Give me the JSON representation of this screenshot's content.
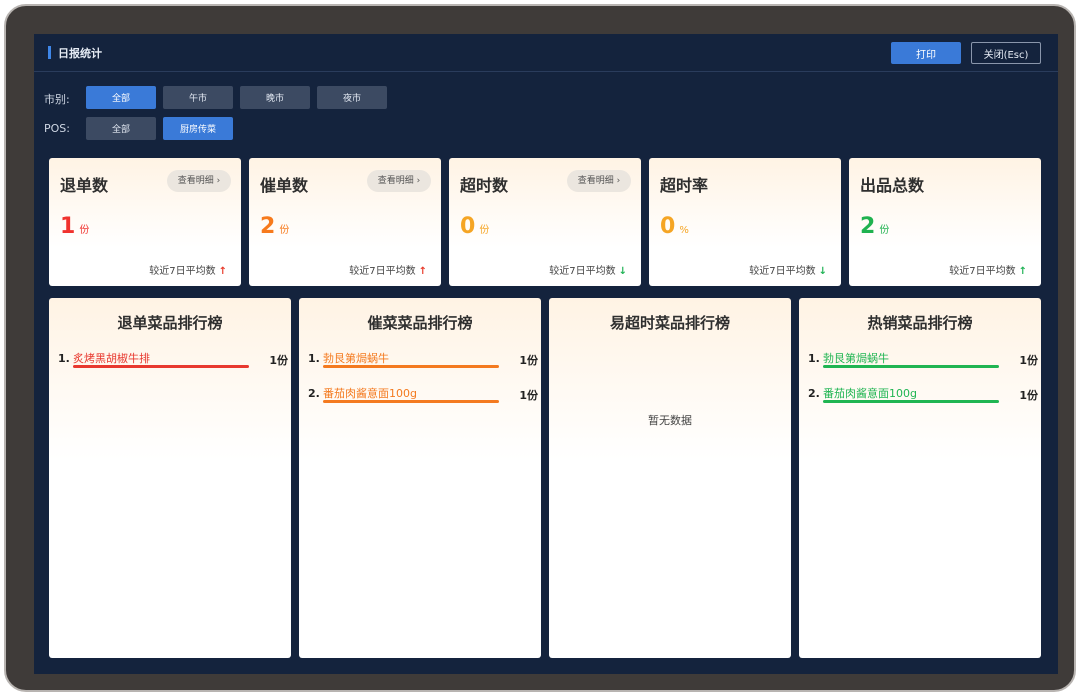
{
  "header": {
    "title": "日报统计",
    "print_label": "打印",
    "close_label": "关闭(Esc)"
  },
  "filters": {
    "market_label": "市别:",
    "market_options": [
      "全部",
      "午市",
      "晚市",
      "夜市"
    ],
    "market_selected": "全部",
    "pos_label": "POS:",
    "pos_options": [
      "全部",
      "厨房传菜"
    ],
    "pos_selected": "厨房传菜"
  },
  "stats": [
    {
      "title": "退单数",
      "detail": "查看明细",
      "value": "1",
      "unit": "份",
      "compare": "较近7日平均数",
      "trend": "up",
      "value_color": "#f0322d",
      "arrow_color": "#e83b2b"
    },
    {
      "title": "催单数",
      "detail": "查看明细",
      "value": "2",
      "unit": "份",
      "compare": "较近7日平均数",
      "trend": "up",
      "value_color": "#f77a1c",
      "arrow_color": "#e83b2b"
    },
    {
      "title": "超时数",
      "detail": "查看明细",
      "value": "0",
      "unit": "份",
      "compare": "较近7日平均数",
      "trend": "down",
      "value_color": "#f5a524",
      "arrow_color": "#22b357"
    },
    {
      "title": "超时率",
      "value": "0",
      "unit": "%",
      "compare": "较近7日平均数",
      "trend": "down",
      "value_color": "#f5a524",
      "arrow_color": "#22b357"
    },
    {
      "title": "出品总数",
      "value": "2",
      "unit": "份",
      "compare": "较近7日平均数",
      "trend": "up",
      "value_color": "#1fb24f",
      "arrow_color": "#22b357"
    }
  ],
  "rankings": [
    {
      "title": "退单菜品排行榜",
      "color": "#e8392f",
      "items": [
        {
          "no": "1.",
          "name": "炙烤黑胡椒牛排",
          "count": "1份",
          "ratio": 1.0
        }
      ]
    },
    {
      "title": "催菜菜品排行榜",
      "color": "#f47a1f",
      "items": [
        {
          "no": "1.",
          "name": "勃艮第焗蜗牛",
          "count": "1份",
          "ratio": 1.0
        },
        {
          "no": "2.",
          "name": "番茄肉酱意面100g",
          "count": "1份",
          "ratio": 1.0
        }
      ]
    },
    {
      "title": "易超时菜品排行榜",
      "color": "#f5a524",
      "items": [],
      "empty_text": "暂无数据"
    },
    {
      "title": "热销菜品排行榜",
      "color": "#20b552",
      "items": [
        {
          "no": "1.",
          "name": "勃艮第焗蜗牛",
          "count": "1份",
          "ratio": 1.0
        },
        {
          "no": "2.",
          "name": "番茄肉酱意面100g",
          "count": "1份",
          "ratio": 1.0
        }
      ]
    }
  ]
}
